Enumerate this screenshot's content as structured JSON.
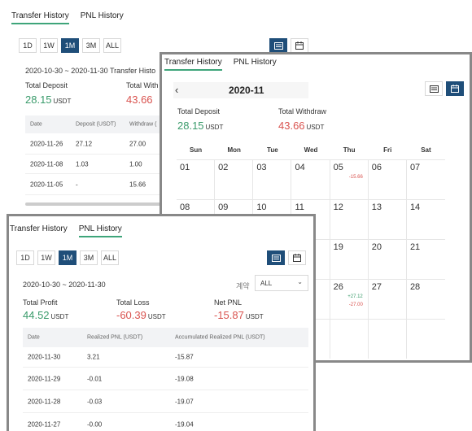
{
  "back_panel": {
    "tabs": [
      "Transfer History",
      "PNL History"
    ],
    "ranges": [
      "1D",
      "1W",
      "1M",
      "3M",
      "ALL"
    ],
    "date_range": "2020-10-30 ~ 2020-11-30 Transfer Histo",
    "total_deposit_label": "Total Deposit",
    "total_deposit_value": "28.15",
    "total_withdraw_label": "Total With",
    "total_withdraw_value": "43.66",
    "unit": "USDT",
    "headers": [
      "Date",
      "Deposit (USDT)",
      "Withdraw ("
    ],
    "rows": [
      [
        "2020-11-26",
        "27.12",
        "27.00"
      ],
      [
        "2020-11-08",
        "1.03",
        "1.00"
      ],
      [
        "2020-11-05",
        "-",
        "15.66"
      ]
    ]
  },
  "cal_panel": {
    "tabs": [
      "Transfer History",
      "PNL History"
    ],
    "prev_icon": "chevron-left-icon",
    "month": "2020-11",
    "total_deposit_label": "Total Deposit",
    "total_deposit_value": "28.15",
    "total_withdraw_label": "Total Withdraw",
    "total_withdraw_value": "43.66",
    "unit": "USDT",
    "weekdays": [
      "Sun",
      "Mon",
      "Tue",
      "Wed",
      "Thu",
      "Fri",
      "Sat"
    ],
    "weeks": [
      [
        {
          "d": "01"
        },
        {
          "d": "02"
        },
        {
          "d": "03"
        },
        {
          "d": "04"
        },
        {
          "d": "05",
          "neg": "-15.66"
        },
        {
          "d": "06"
        },
        {
          "d": "07"
        }
      ],
      [
        {
          "d": "08"
        },
        {
          "d": "09"
        },
        {
          "d": "10"
        },
        {
          "d": "11"
        },
        {
          "d": "12"
        },
        {
          "d": "13"
        },
        {
          "d": "14"
        }
      ],
      [
        {
          "d": ""
        },
        {
          "d": ""
        },
        {
          "d": ""
        },
        {
          "d": ""
        },
        {
          "d": "19"
        },
        {
          "d": "20"
        },
        {
          "d": "21"
        }
      ],
      [
        {
          "d": ""
        },
        {
          "d": ""
        },
        {
          "d": ""
        },
        {
          "d": ""
        },
        {
          "d": "26",
          "pos": "+27.12",
          "neg": "-27.00"
        },
        {
          "d": "27"
        },
        {
          "d": "28"
        }
      ],
      [
        {
          "d": ""
        },
        {
          "d": ""
        },
        {
          "d": ""
        },
        {
          "d": ""
        },
        {
          "d": ""
        },
        {
          "d": ""
        },
        {
          "d": ""
        }
      ]
    ]
  },
  "pnl_panel": {
    "tabs": [
      "Transfer History",
      "PNL History"
    ],
    "ranges": [
      "1D",
      "1W",
      "1M",
      "3M",
      "ALL"
    ],
    "date_range": "2020-10-30 ~ 2020-11-30",
    "contract_label": "계약",
    "contract_value": "ALL",
    "total_profit_label": "Total Profit",
    "total_profit_value": "44.52",
    "total_loss_label": "Total Loss",
    "total_loss_value": "-60.39",
    "net_pnl_label": "Net PNL",
    "net_pnl_value": "-15.87",
    "unit": "USDT",
    "headers": [
      "Date",
      "Realized PNL (USDT)",
      "Accumulated Realized PNL (USDT)"
    ],
    "rows": [
      [
        "2020-11-30",
        "3.21",
        "-15.87"
      ],
      [
        "2020-11-29",
        "-0.01",
        "-19.08"
      ],
      [
        "2020-11-28",
        "-0.03",
        "-19.07"
      ],
      [
        "2020-11-27",
        "-0.00",
        "-19.04"
      ]
    ]
  },
  "colors": {
    "accent": "#1f4e79",
    "positive": "#3a9b6b",
    "negative": "#d9534f",
    "tab_underline": "#3ea57a"
  }
}
